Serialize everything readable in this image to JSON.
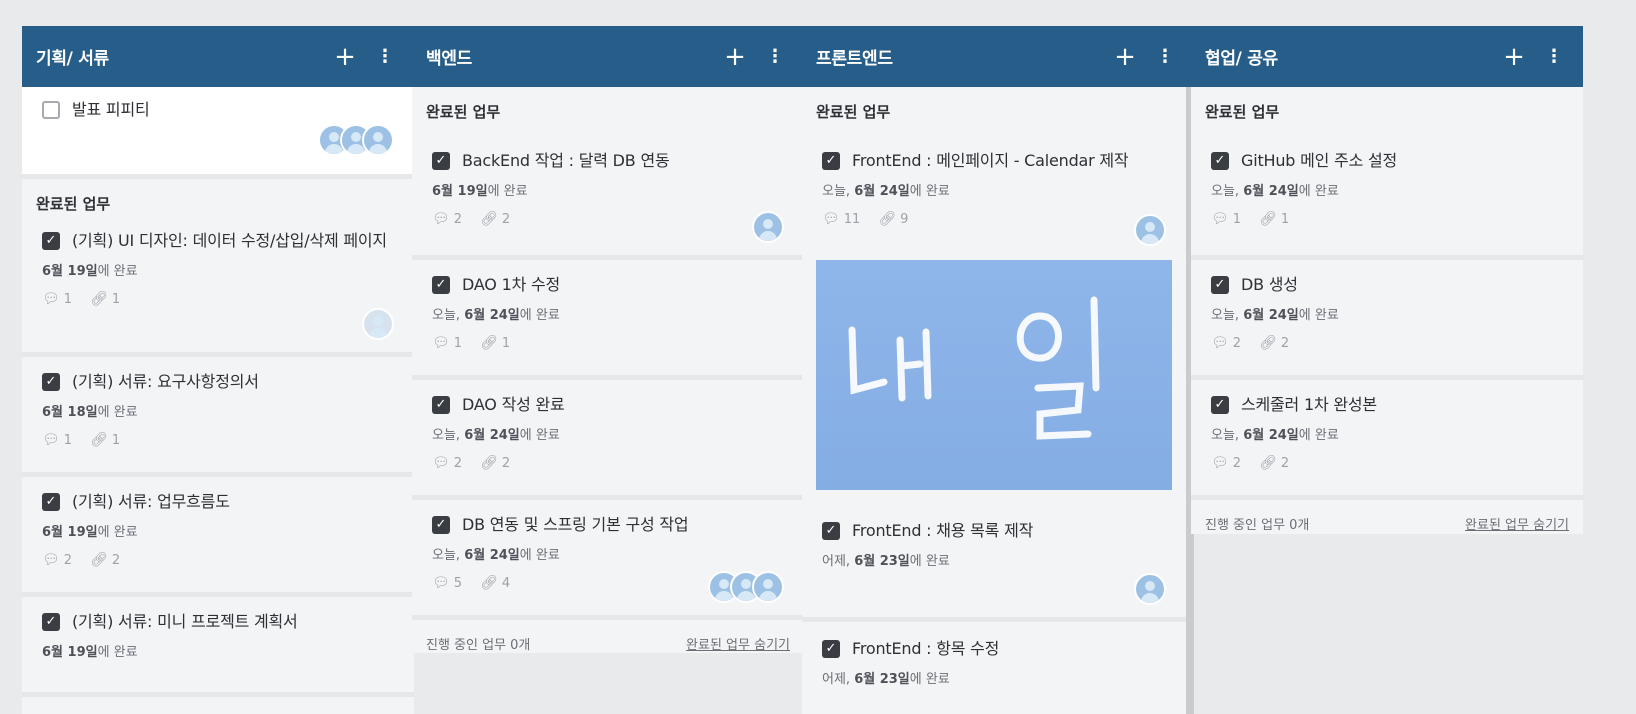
{
  "columns": [
    {
      "title": "기획/ 서류",
      "add": "+",
      "more": "⋮",
      "top_card": {
        "title": "발표 피피티"
      },
      "section": "완료된 업무",
      "cards": [
        {
          "title": "(기획) UI 디자인: 데이터 수정/삽입/삭제 페이지",
          "date": "6월 19일",
          "suffix": "에 완료",
          "comments": "1",
          "attachments": "1"
        },
        {
          "title": "(기획) 서류: 요구사항정의서",
          "date": "6월 18일",
          "suffix": "에 완료",
          "comments": "1",
          "attachments": "1"
        },
        {
          "title": "(기획) 서류: 업무흐름도",
          "date": "6월 19일",
          "suffix": "에 완료",
          "comments": "2",
          "attachments": "2"
        },
        {
          "title": "(기획) 서류: 미니 프로젝트 계획서",
          "date": "6월 19일",
          "suffix": "에 완료",
          "comments": "",
          "attachments": ""
        }
      ]
    },
    {
      "title": "백엔드",
      "add": "+",
      "more": "⋮",
      "section": "완료된 업무",
      "cards": [
        {
          "title": "BackEnd 작업 : 달력 DB 연동",
          "prefix": "",
          "date": "6월 19일",
          "suffix": "에 완료",
          "comments": "2",
          "attachments": "2"
        },
        {
          "title": "DAO 1차 수정",
          "prefix": "오늘, ",
          "date": "6월 24일",
          "suffix": "에 완료",
          "comments": "1",
          "attachments": "1"
        },
        {
          "title": "DAO 작성 완료",
          "prefix": "오늘, ",
          "date": "6월 24일",
          "suffix": "에 완료",
          "comments": "2",
          "attachments": "2"
        },
        {
          "title": "DB 연동 및 스프링 기본 구성 작업",
          "prefix": "오늘, ",
          "date": "6월 24일",
          "suffix": "에 완료",
          "comments": "5",
          "attachments": "4"
        }
      ],
      "footer_left": "진행 중인 업무 0개",
      "footer_right": "완료된 업무 숨기기"
    },
    {
      "title": "프론트엔드",
      "add": "+",
      "more": "⋮",
      "section": "완료된 업무",
      "cards": [
        {
          "title": "FrontEnd : 메인페이지 - Calendar 제작",
          "prefix": "오늘, ",
          "date": "6월 24일",
          "suffix": "에 완료",
          "comments": "11",
          "attachments": "9"
        },
        {
          "title": "FrontEnd : 채용 목록 제작",
          "prefix": "어제, ",
          "date": "6월 23일",
          "suffix": "에 완료"
        },
        {
          "title": "FrontEnd : 항목 수정",
          "prefix": "어제, ",
          "date": "6월 23일",
          "suffix": "에 완료"
        }
      ]
    },
    {
      "title": "협업/ 공유",
      "add": "+",
      "more": "⋮",
      "section": "완료된 업무",
      "cards": [
        {
          "title": "GitHub 메인 주소 설정",
          "prefix": "오늘, ",
          "date": "6월 24일",
          "suffix": "에 완료",
          "comments": "1",
          "attachments": "1"
        },
        {
          "title": "DB 생성",
          "prefix": "오늘, ",
          "date": "6월 24일",
          "suffix": "에 완료",
          "comments": "2",
          "attachments": "2"
        },
        {
          "title": "스케줄러 1차 완성본",
          "prefix": "오늘, ",
          "date": "6월 24일",
          "suffix": "에 완료",
          "comments": "2",
          "attachments": "2"
        }
      ],
      "footer_left": "진행 중인 업무 0개",
      "footer_right": "완료된 업무 숨기기"
    }
  ],
  "icons": {
    "comment": "comment-icon",
    "attachment": "paperclip-icon",
    "check": "checkbox-checked-icon"
  },
  "colors": {
    "header": "#275e89",
    "avatar": "#9cc1e4",
    "cover": "#8fb6ea"
  }
}
